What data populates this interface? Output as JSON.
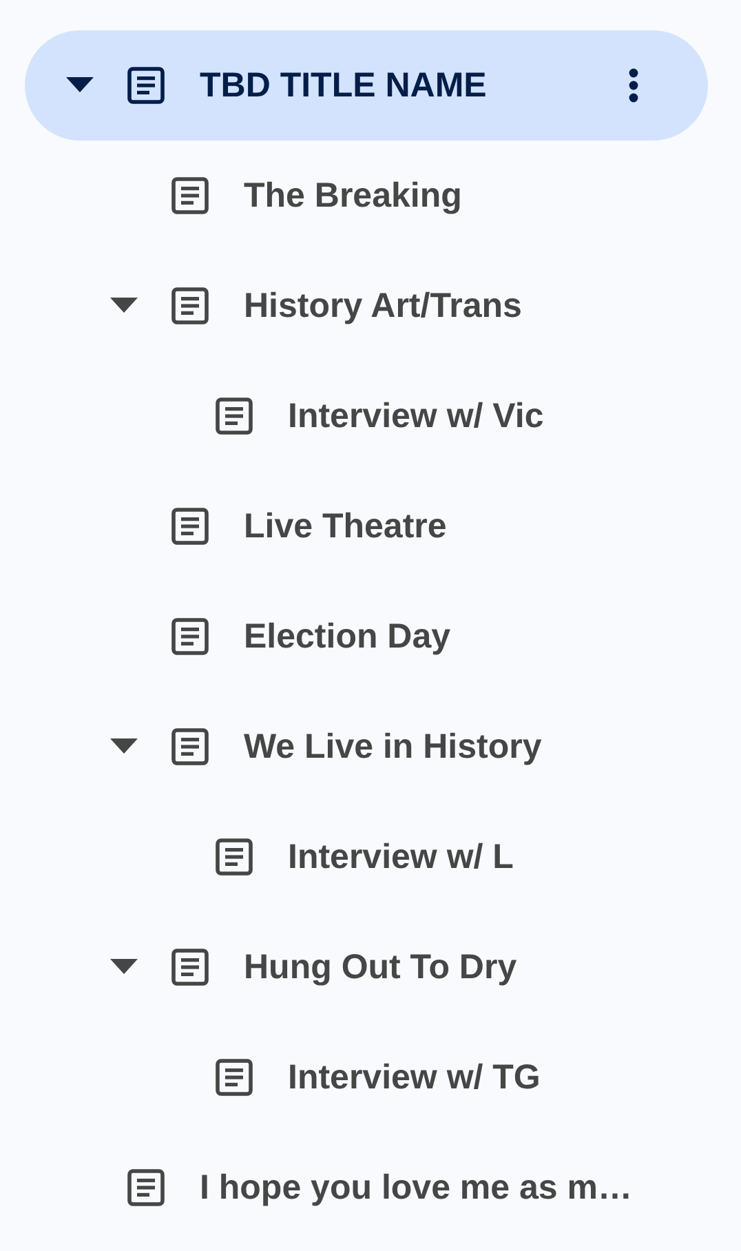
{
  "tree": [
    {
      "label": "TBD TITLE NAME",
      "selected": true,
      "expanded": true,
      "children": [
        {
          "label": "The Breaking",
          "selected": false
        },
        {
          "label": "History Art/Trans",
          "selected": false,
          "expanded": true,
          "children": [
            {
              "label": "Interview w/ Vic",
              "selected": false
            }
          ]
        },
        {
          "label": "Live Theatre",
          "selected": false
        },
        {
          "label": "Election Day",
          "selected": false
        },
        {
          "label": "We Live in History",
          "selected": false,
          "expanded": true,
          "children": [
            {
              "label": "Interview w/ L",
              "selected": false
            }
          ]
        },
        {
          "label": "Hung Out To Dry",
          "selected": false,
          "expanded": true,
          "children": [
            {
              "label": "Interview w/ TG",
              "selected": false
            }
          ]
        }
      ]
    },
    {
      "label": "I hope you love me as m…",
      "selected": false
    }
  ]
}
